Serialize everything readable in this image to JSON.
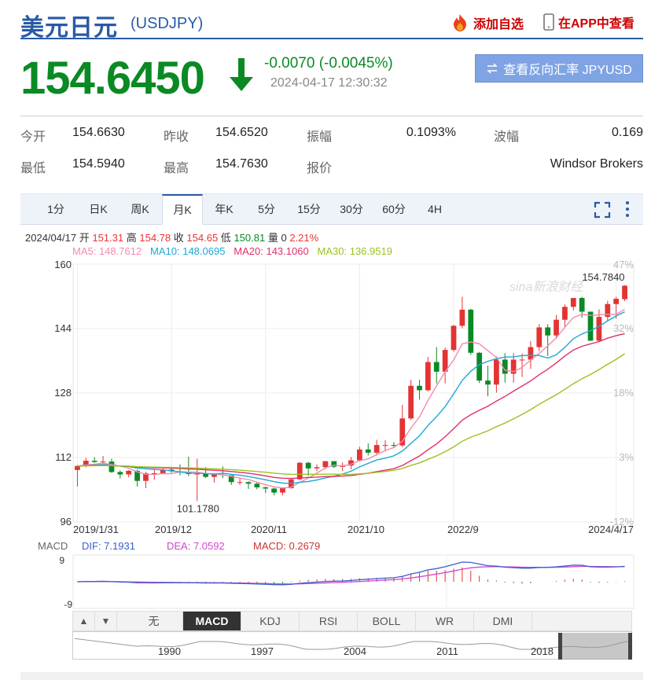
{
  "header": {
    "title": "美元日元",
    "code": "(USDJPY)",
    "add_label": "添加自选",
    "app_label": "在APP中查看"
  },
  "quote": {
    "price": "154.6450",
    "change": "-0.0070 (-0.0045%)",
    "timestamp": "2024-04-17 12:30:32",
    "reverse_label": "查看反向汇率 JPYUSD"
  },
  "stats": {
    "open_label": "今开",
    "open": "154.6630",
    "prev_label": "昨收",
    "prev": "154.6520",
    "amp_label": "振幅",
    "amp": "0.1093%",
    "wave_label": "波幅",
    "wave": "0.169",
    "low_label": "最低",
    "low": "154.5940",
    "high_label": "最高",
    "high": "154.7630",
    "quote_label": "报价",
    "quoter": "Windsor Brokers"
  },
  "tabs": [
    "1分",
    "日K",
    "周K",
    "月K",
    "年K",
    "5分",
    "15分",
    "30分",
    "60分",
    "4H"
  ],
  "active_tab": "月K",
  "kline_info": {
    "date": "2024/04/17",
    "open_label": "开",
    "open": "151.31",
    "high_label": "高",
    "high": "154.78",
    "close_label": "收",
    "close": "154.65",
    "low_label": "低",
    "low": "150.81",
    "vol_label": "量",
    "vol": "0",
    "pct": "2.21%"
  },
  "ma_info": {
    "ma5": "MA5: 148.7612",
    "ma10": "MA10: 148.0695",
    "ma20": "MA20: 143.1060",
    "ma30": "MA30: 136.9519"
  },
  "macd_info": {
    "label": "MACD",
    "dif": "DIF: 7.1931",
    "dea": "DEA: 7.0592",
    "macd": "MACD: 0.2679"
  },
  "indicator_tabs": [
    "无",
    "MACD",
    "KDJ",
    "RSI",
    "BOLL",
    "WR",
    "DMI"
  ],
  "active_indicator": "MACD",
  "nav_years": [
    "1990",
    "1997",
    "2004",
    "2011",
    "2018"
  ],
  "watermark": "sina新浪财经",
  "colors": {
    "up": "#e33333",
    "down": "#0a8a24",
    "ma5": "#f08cae",
    "ma10": "#1ea8d6",
    "ma20": "#e0306a",
    "ma30": "#9ac21e",
    "dif": "#3a5fcd",
    "dea": "#d048d0"
  },
  "chart_data": {
    "type": "candlestick",
    "title": "",
    "ylim": [
      96,
      160
    ],
    "y_ticks": [
      "160",
      "144",
      "128",
      "112",
      "96"
    ],
    "y_ticks_right": [
      "47%",
      "32%",
      "18%",
      "3%",
      "-12%"
    ],
    "x_ticks": [
      "2019/1/31",
      "2019/12",
      "2020/11",
      "2021/10",
      "2022/9",
      "2024/4/17"
    ],
    "max_label": "154.7840",
    "min_label": "101.1780",
    "x_start": "2019-01",
    "candles": [
      [
        108.9,
        109.9,
        104.8,
        110.1
      ],
      [
        109.9,
        111.2,
        109.6,
        111.9
      ],
      [
        111.2,
        110.9,
        110.7,
        112.1
      ],
      [
        110.9,
        111.0,
        110.6,
        112.4
      ],
      [
        111.0,
        108.4,
        108.2,
        111.7
      ],
      [
        108.4,
        107.8,
        106.8,
        108.8
      ],
      [
        107.8,
        108.7,
        107.1,
        108.9
      ],
      [
        108.7,
        106.2,
        104.8,
        109.0
      ],
      [
        106.2,
        108.1,
        104.4,
        108.5
      ],
      [
        108.1,
        108.1,
        106.5,
        109.2
      ],
      [
        108.1,
        109.0,
        107.9,
        109.5
      ],
      [
        109.0,
        108.6,
        108.2,
        109.7
      ],
      [
        108.6,
        108.4,
        107.6,
        110.3
      ],
      [
        108.4,
        107.9,
        107.4,
        112.2
      ],
      [
        107.9,
        108.0,
        101.2,
        111.7
      ],
      [
        108.0,
        107.2,
        106.9,
        109.6
      ],
      [
        107.2,
        107.8,
        105.8,
        108.1
      ],
      [
        107.8,
        107.6,
        106.9,
        109.8
      ],
      [
        107.6,
        105.9,
        105.2,
        107.5
      ],
      [
        105.9,
        105.9,
        105.2,
        107.0
      ],
      [
        105.9,
        105.5,
        104.2,
        106.1
      ],
      [
        105.5,
        104.6,
        104.1,
        105.8
      ],
      [
        104.6,
        104.3,
        103.2,
        104.8
      ],
      [
        104.3,
        103.3,
        102.6,
        104.5
      ],
      [
        103.3,
        104.4,
        102.6,
        104.6
      ],
      [
        104.4,
        106.6,
        104.3,
        106.6
      ],
      [
        106.6,
        110.7,
        106.4,
        110.9
      ],
      [
        110.7,
        109.3,
        107.5,
        110.9
      ],
      [
        109.3,
        109.6,
        108.6,
        110.3
      ],
      [
        109.6,
        111.1,
        109.1,
        111.1
      ],
      [
        111.1,
        109.7,
        109.4,
        111.0
      ],
      [
        109.7,
        110.0,
        108.7,
        110.8
      ],
      [
        110.0,
        111.3,
        109.1,
        112.1
      ],
      [
        111.3,
        114.0,
        111.2,
        114.7
      ],
      [
        114.0,
        113.2,
        112.5,
        115.5
      ],
      [
        113.2,
        115.1,
        112.5,
        116.4
      ],
      [
        115.1,
        115.1,
        113.5,
        116.3
      ],
      [
        115.1,
        115.0,
        114.4,
        115.8
      ],
      [
        115.0,
        121.7,
        114.6,
        125.1
      ],
      [
        121.7,
        129.8,
        121.3,
        131.3
      ],
      [
        129.8,
        128.7,
        126.4,
        131.3
      ],
      [
        128.7,
        135.7,
        128.4,
        137.0
      ],
      [
        135.7,
        133.3,
        130.4,
        139.4
      ],
      [
        133.3,
        138.7,
        130.4,
        139.3
      ],
      [
        138.7,
        144.7,
        138.3,
        144.9
      ],
      [
        144.7,
        148.7,
        144.1,
        151.9
      ],
      [
        148.7,
        138.0,
        137.5,
        148.9
      ],
      [
        138.0,
        131.1,
        130.5,
        138.2
      ],
      [
        131.1,
        130.1,
        127.2,
        134.8
      ],
      [
        130.1,
        136.3,
        128.1,
        137.1
      ],
      [
        136.3,
        132.8,
        130.6,
        137.9
      ],
      [
        132.8,
        136.3,
        130.6,
        137.9
      ],
      [
        136.3,
        136.3,
        132.0,
        137.8
      ],
      [
        136.3,
        139.4,
        134.0,
        140.9
      ],
      [
        139.4,
        144.3,
        138.4,
        145.1
      ],
      [
        144.3,
        142.3,
        137.2,
        145.1
      ],
      [
        142.3,
        146.2,
        141.5,
        147.4
      ],
      [
        146.2,
        149.4,
        144.4,
        150.0
      ],
      [
        149.4,
        151.6,
        148.5,
        151.5
      ],
      [
        151.6,
        148.2,
        146.7,
        151.9
      ],
      [
        148.2,
        141.0,
        140.9,
        148.2
      ],
      [
        141.0,
        146.9,
        140.8,
        148.8
      ],
      [
        146.9,
        150.1,
        146.0,
        150.9
      ],
      [
        150.1,
        151.4,
        146.5,
        151.9
      ],
      [
        151.31,
        154.65,
        150.81,
        154.78
      ]
    ],
    "macd": {
      "ylim": [
        -9,
        9
      ],
      "dif_last": 7.1931,
      "dea_last": 7.0592,
      "hist_last": 0.2679
    }
  }
}
